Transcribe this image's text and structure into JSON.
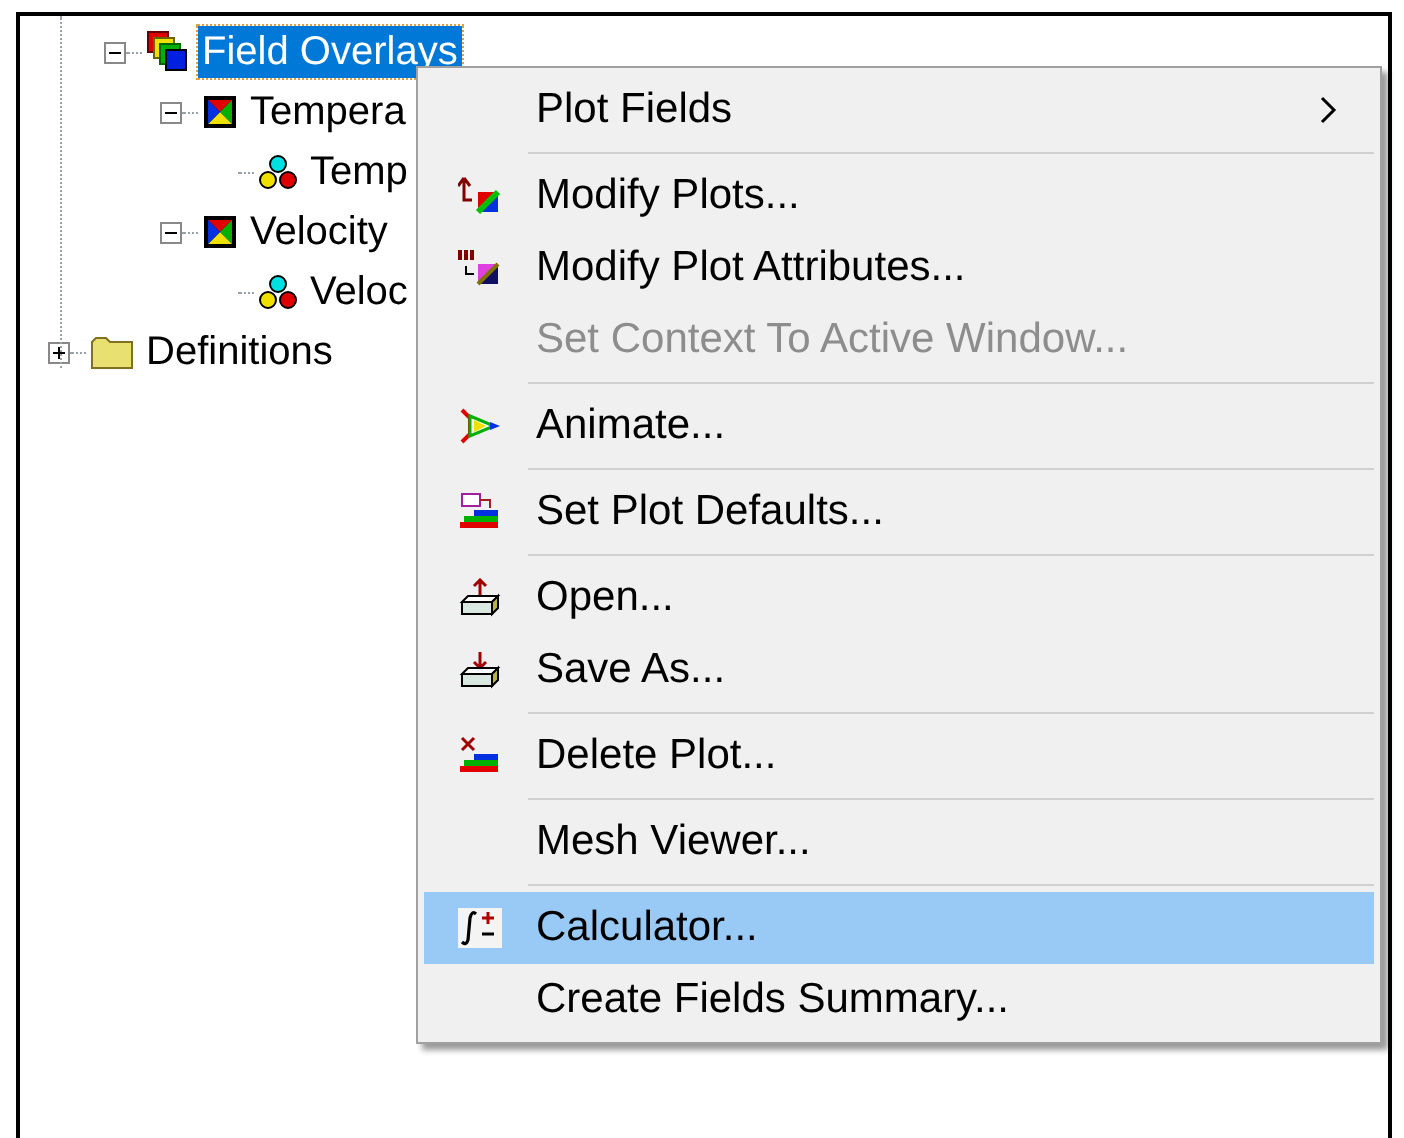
{
  "tree": [
    {
      "label": "Field Overlays",
      "kind": "overlays",
      "expanded": true,
      "selected": true,
      "children": [
        {
          "label": "Tempera",
          "kind": "plot",
          "expanded": true,
          "selected": false,
          "children": [
            {
              "label": "Temp",
              "kind": "field",
              "selected": false
            }
          ]
        },
        {
          "label": "Velocity",
          "kind": "plot",
          "expanded": true,
          "selected": false,
          "children": [
            {
              "label": "Veloc",
              "kind": "field",
              "selected": false
            }
          ]
        }
      ]
    },
    {
      "label": "Definitions",
      "kind": "folder",
      "expanded": false,
      "selected": false
    }
  ],
  "context_menu": {
    "sections": [
      [
        {
          "label": "Plot Fields",
          "kind": "none",
          "submenu": true,
          "disabled": false,
          "selected": false
        }
      ],
      [
        {
          "label": "Modify Plots...",
          "kind": "modify",
          "submenu": false,
          "disabled": false,
          "selected": false
        },
        {
          "label": "Modify Plot Attributes...",
          "kind": "attributes",
          "submenu": false,
          "disabled": false,
          "selected": false
        },
        {
          "label": "Set Context To Active Window...",
          "kind": "none",
          "submenu": false,
          "disabled": true,
          "selected": false
        }
      ],
      [
        {
          "label": "Animate...",
          "kind": "animate",
          "submenu": false,
          "disabled": false,
          "selected": false
        }
      ],
      [
        {
          "label": "Set Plot Defaults...",
          "kind": "defaults",
          "submenu": false,
          "disabled": false,
          "selected": false
        }
      ],
      [
        {
          "label": "Open...",
          "kind": "open",
          "submenu": false,
          "disabled": false,
          "selected": false
        },
        {
          "label": "Save As...",
          "kind": "save",
          "submenu": false,
          "disabled": false,
          "selected": false
        }
      ],
      [
        {
          "label": "Delete Plot...",
          "kind": "delete",
          "submenu": false,
          "disabled": false,
          "selected": false
        }
      ],
      [
        {
          "label": "Mesh Viewer...",
          "kind": "none",
          "submenu": false,
          "disabled": false,
          "selected": false
        }
      ],
      [
        {
          "label": "Calculator...",
          "kind": "calculator",
          "submenu": false,
          "disabled": false,
          "selected": true
        },
        {
          "label": "Create Fields Summary...",
          "kind": "none",
          "submenu": false,
          "disabled": false,
          "selected": false
        }
      ]
    ]
  }
}
